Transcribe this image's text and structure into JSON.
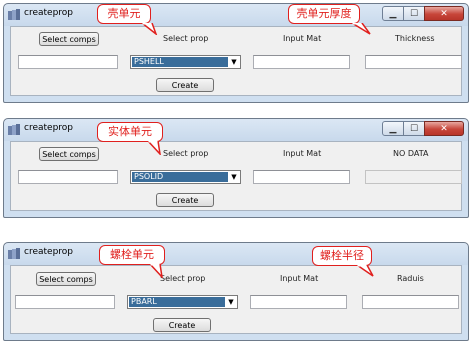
{
  "windows": [
    {
      "title": "createprop",
      "select_comps_label": "Select comps",
      "select_prop_header": "Select prop",
      "input_mat_header": "Input Mat",
      "fourth_header": "Thickness",
      "prop_value": "PSHELL",
      "create_label": "Create",
      "callout_left": "壳单元",
      "callout_right": "壳单元厚度"
    },
    {
      "title": "createprop",
      "select_comps_label": "Select comps",
      "select_prop_header": "Select prop",
      "input_mat_header": "Input Mat",
      "fourth_header": "NO DATA",
      "prop_value": "PSOLID",
      "create_label": "Create",
      "callout_left": "实体单元"
    },
    {
      "title": "createprop",
      "select_comps_label": "Select comps",
      "select_prop_header": "Select prop",
      "input_mat_header": "Input Mat",
      "fourth_header": "Raduis",
      "prop_value": "PBARL",
      "create_label": "Create",
      "callout_left": "螺栓单元",
      "callout_right": "螺栓半径"
    }
  ],
  "icons": {
    "app": "app-icon",
    "minimize": "minimize-icon",
    "maximize": "maximize-icon",
    "close": "close-icon",
    "dropdown": "chevron-down-icon"
  },
  "colors": {
    "callout_red": "#e0201e",
    "selection_blue": "#3a6d9a",
    "close_red": "#c7463a"
  }
}
